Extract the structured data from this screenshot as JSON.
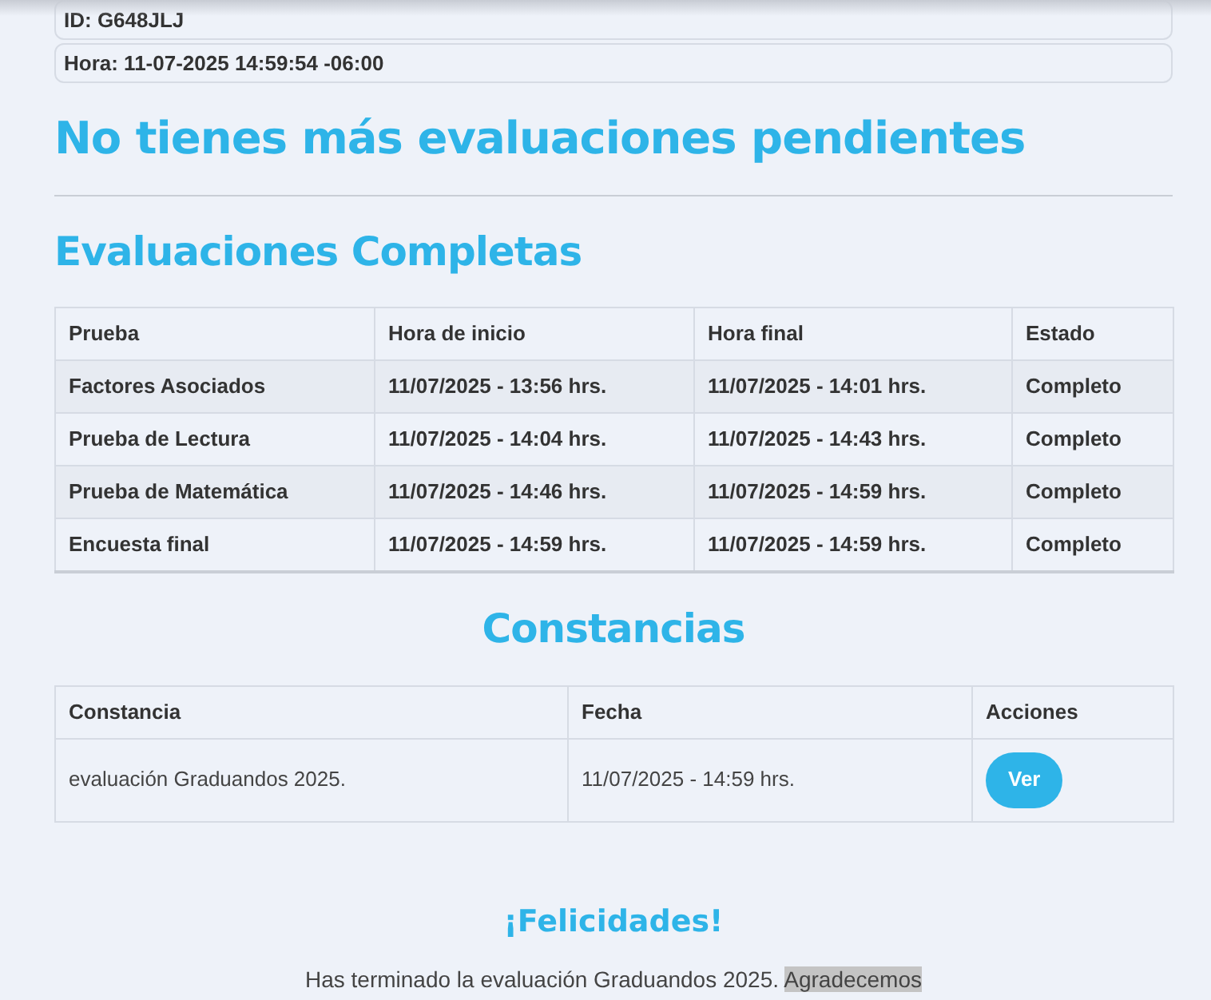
{
  "info": [
    "ID: G648JLJ",
    "Hora: 11-07-2025 14:59:54 -06:00"
  ],
  "pending_title": "No tienes más evaluaciones pendientes",
  "completed": {
    "title": "Evaluaciones Completas",
    "columns": [
      "Prueba",
      "Hora de inicio",
      "Hora final",
      "Estado"
    ],
    "rows": [
      [
        "Factores Asociados",
        "11/07/2025 - 13:56 hrs.",
        "11/07/2025 - 14:01 hrs.",
        "Completo"
      ],
      [
        "Prueba de Lectura",
        "11/07/2025 - 14:04 hrs.",
        "11/07/2025 - 14:43 hrs.",
        "Completo"
      ],
      [
        "Prueba de Matemática",
        "11/07/2025 - 14:46 hrs.",
        "11/07/2025 - 14:59 hrs.",
        "Completo"
      ],
      [
        "Encuesta final",
        "11/07/2025 - 14:59 hrs.",
        "11/07/2025 - 14:59 hrs.",
        "Completo"
      ]
    ]
  },
  "certificates": {
    "title": "Constancias",
    "columns": [
      "Constancia",
      "Fecha",
      "Acciones"
    ],
    "rows": [
      {
        "name": "evaluación Graduandos 2025.",
        "date": "11/07/2025 - 14:59 hrs.",
        "action": "Ver"
      }
    ]
  },
  "congrats": {
    "title": "¡Felicidades!",
    "message": "Has terminado la evaluación Graduandos 2025.",
    "selected_text": "Agradecemos"
  }
}
